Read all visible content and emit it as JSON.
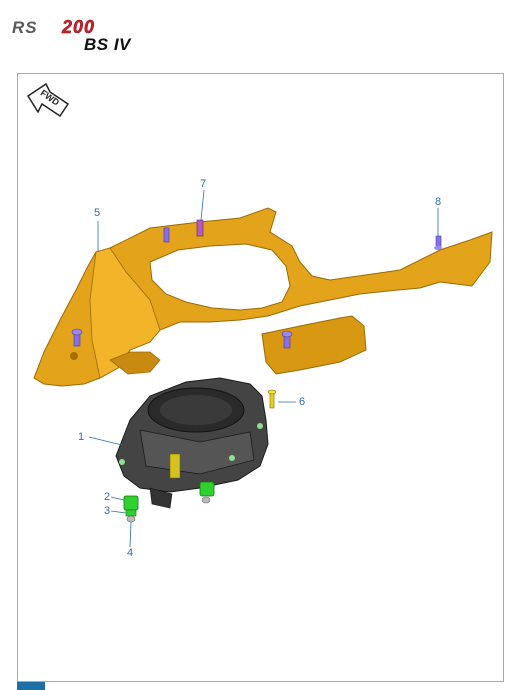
{
  "header": {
    "model": "RS",
    "model_number": "200",
    "variant": "BS IV"
  },
  "fwd_label": "FWD",
  "colors": {
    "frame_border": "#7fb6d6",
    "callout": "#2a6ea6",
    "fairing_yellow": "#e3a31a",
    "headlamp_dark": "#3c3c3c",
    "grommet_green": "#2fd02f",
    "screw_purple": "#8a6ee6"
  },
  "callouts": [
    {
      "id": "1",
      "label": "1"
    },
    {
      "id": "2",
      "label": "2"
    },
    {
      "id": "3",
      "label": "3"
    },
    {
      "id": "4",
      "label": "4"
    },
    {
      "id": "5",
      "label": "5"
    },
    {
      "id": "6",
      "label": "6"
    },
    {
      "id": "7",
      "label": "7"
    },
    {
      "id": "8",
      "label": "8"
    }
  ]
}
